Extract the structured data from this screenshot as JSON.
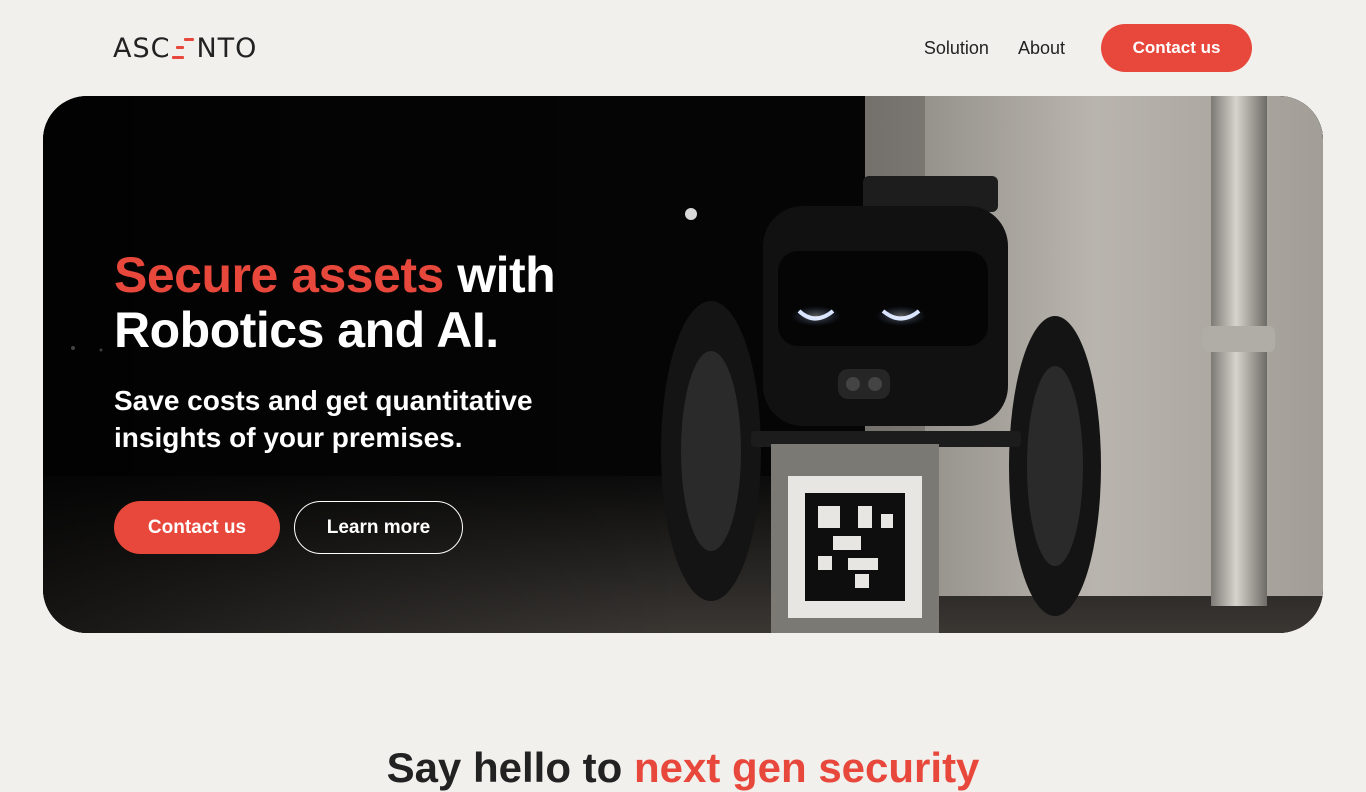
{
  "header": {
    "logo_text_left": "ASC",
    "logo_text_right": "NTO",
    "nav": [
      {
        "label": "Solution"
      },
      {
        "label": "About"
      }
    ],
    "cta_label": "Contact us"
  },
  "hero": {
    "title_accent": "Secure assets",
    "title_rest_1": " with",
    "title_line2": "Robotics and AI.",
    "subtitle": "Save costs and get quantitative insights of your premises.",
    "primary_button": "Contact us",
    "secondary_button": "Learn more"
  },
  "section": {
    "title_part": "Say hello to ",
    "title_accent": "next gen security"
  },
  "colors": {
    "accent": "#e8483b",
    "background": "#f1f0ed",
    "text": "#222222"
  }
}
